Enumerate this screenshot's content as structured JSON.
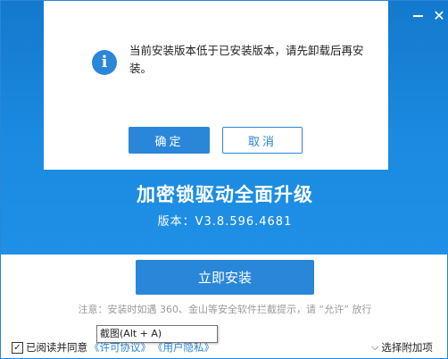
{
  "window": {
    "minimize_label": "—",
    "close_label": "✕"
  },
  "product": {
    "title": "加密锁驱动全面升级",
    "version": "版本：V3.8.596.4681"
  },
  "dialog": {
    "icon": "info-icon",
    "message": "当前安装版本低于已安装版本，请先卸载后再安装。",
    "ok_label": "确定",
    "cancel_label": "取消"
  },
  "install": {
    "button_label": "立即安装",
    "notice": "注意：安装时如遇 360、金山等安全软件拦截提示，请 “允许” 放行"
  },
  "tooltip": {
    "text": "截图(Alt + A)"
  },
  "footer": {
    "agree_checked": true,
    "agree_label": "已阅读并同意",
    "license_link": "《许可协议》",
    "privacy_link": "《用户隐私》",
    "extra_label": "选择附加项"
  },
  "colors": {
    "accent": "#2a86d8",
    "hero_top": "#1479cd",
    "hero_bottom": "#1f90e6"
  }
}
